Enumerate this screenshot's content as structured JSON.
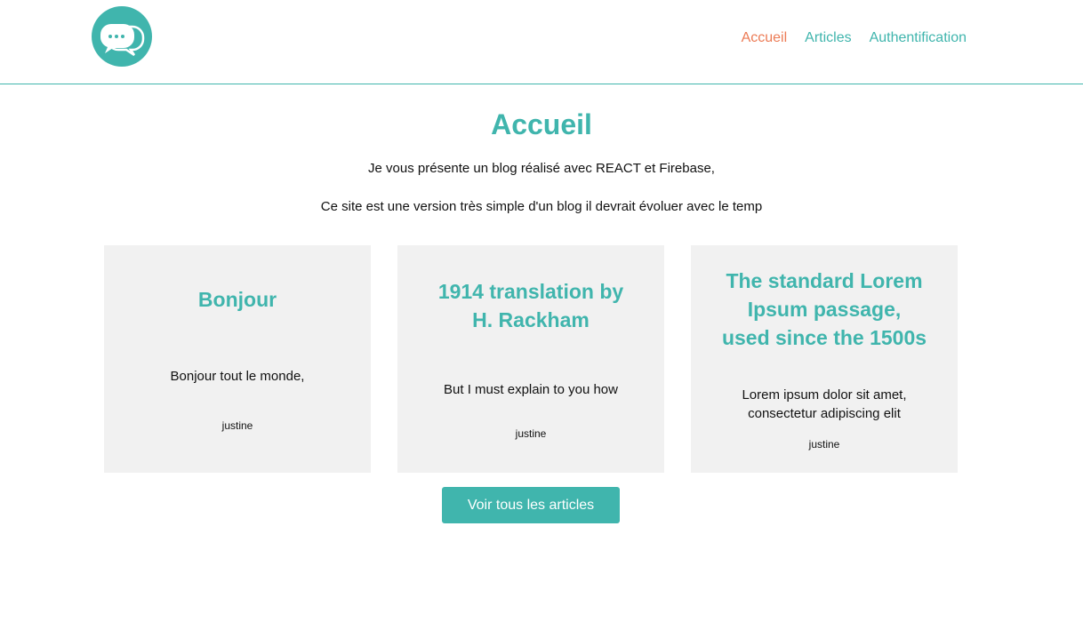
{
  "header": {
    "logo_icon": "chat-bubbles-icon",
    "nav": [
      {
        "label": "Accueil",
        "active": true
      },
      {
        "label": "Articles",
        "active": false
      },
      {
        "label": "Authentification",
        "active": false
      }
    ]
  },
  "main": {
    "title": "Accueil",
    "intro_1": "Je vous présente un blog réalisé avec REACT et Firebase,",
    "intro_2": "Ce site est une version très simple d'un blog il devrait évoluer avec le temp",
    "cards": [
      {
        "title": "Bonjour",
        "excerpt": "Bonjour tout le monde,",
        "author": "justine"
      },
      {
        "title": "1914 translation by H. Rackham",
        "excerpt": "But I must explain to you how",
        "author": "justine"
      },
      {
        "title": "The standard Lorem Ipsum passage, used since the 1500s",
        "excerpt": "Lorem ipsum dolor sit amet, consectetur adipiscing elit",
        "author": "justine"
      }
    ],
    "cta_label": "Voir tous les articles"
  },
  "colors": {
    "accent": "#40b5ad",
    "active_nav": "#ec7b55",
    "card_bg": "#f1f1f1"
  }
}
